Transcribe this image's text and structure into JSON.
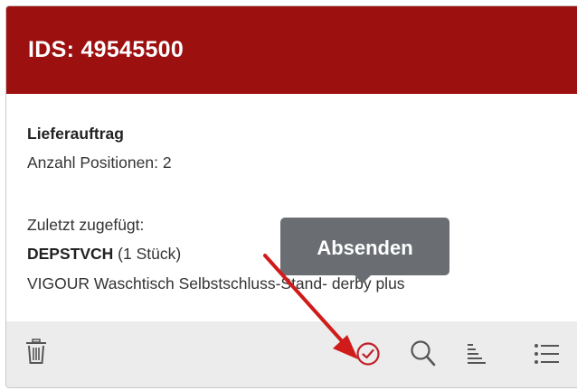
{
  "card": {
    "title": "IDS: 49545500",
    "type_label": "Lieferauftrag",
    "positions_label": "Anzahl Positionen: 2",
    "last_added_label": "Zuletzt zugefügt:",
    "item_code": "DEPSTVCH",
    "item_qty": " (1 Stück)",
    "item_description": "VIGOUR Waschtisch Selbstschluss-Stand- derby plus"
  },
  "tooltip": {
    "label": "Absenden"
  },
  "toolbar": {
    "icons": [
      "trash-icon",
      "check-circle-icon",
      "search-icon",
      "sort-icon",
      "list-icon"
    ]
  },
  "colors": {
    "header": "#9c1010",
    "footer": "#ececec",
    "icon": "#555555",
    "accent": "#c21f2a",
    "tooltip": "#6a6e72",
    "annotation_arrow": "#d01b1b"
  }
}
